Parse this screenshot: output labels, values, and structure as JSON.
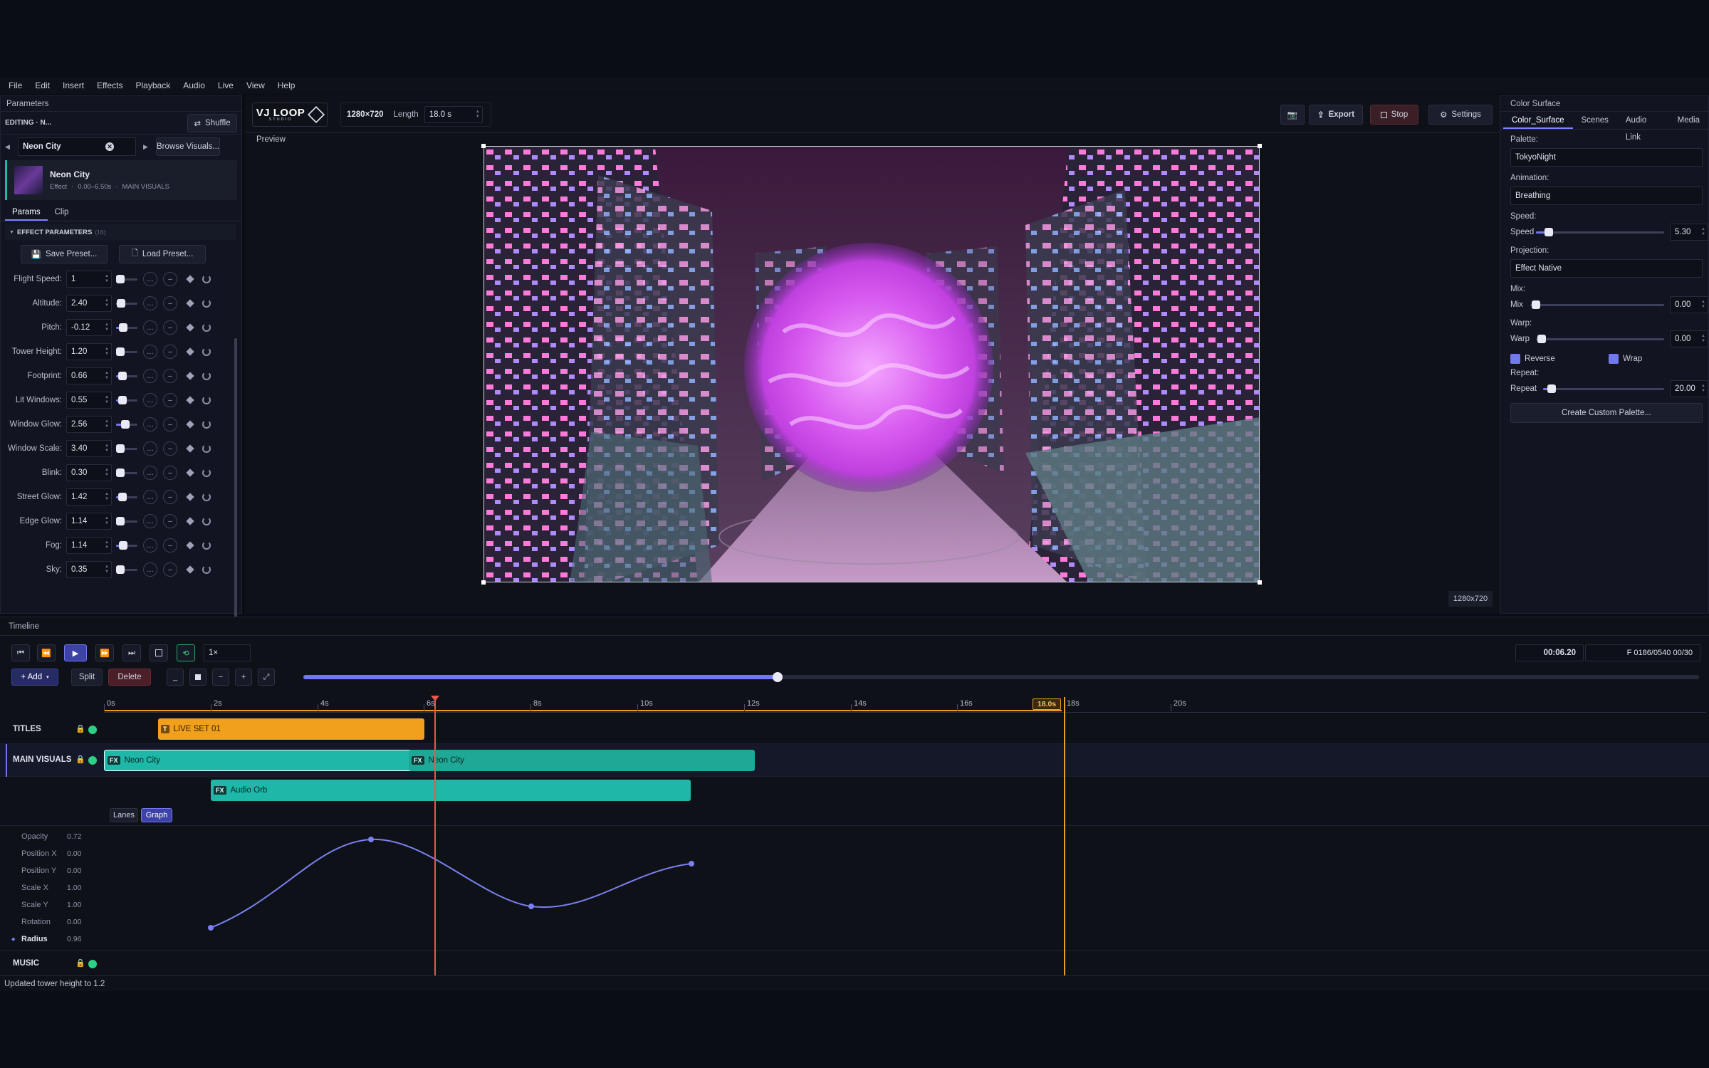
{
  "menu": [
    "File",
    "Edit",
    "Insert",
    "Effects",
    "Playback",
    "Audio",
    "Live",
    "View",
    "Help"
  ],
  "left": {
    "title": "Parameters",
    "editing": "EDITING · N...",
    "shuffle": "Shuffle",
    "effect_name": "Neon City",
    "browse": "Browse Visuals...",
    "card": {
      "name": "Neon City",
      "meta1": "Effect",
      "meta2": "0.00–6.50s",
      "meta3": "MAIN VISUALS"
    },
    "tabs": [
      "Params",
      "Clip"
    ],
    "section": "EFFECT PARAMETERS",
    "section_count": "(16)",
    "save_preset": "Save Preset...",
    "load_preset": "Load Preset...",
    "params": [
      {
        "label": "Flight Speed:",
        "value": "1",
        "level": 0.08
      },
      {
        "label": "Altitude:",
        "value": "2.40",
        "level": 0.22
      },
      {
        "label": "Pitch:",
        "value": "-0.12",
        "level": 0.32
      },
      {
        "label": "Tower Height:",
        "value": "1.20",
        "level": 0.2
      },
      {
        "label": "Footprint:",
        "value": "0.66",
        "level": 0.3
      },
      {
        "label": "Lit Windows:",
        "value": "0.55",
        "level": 0.3
      },
      {
        "label": "Window Glow:",
        "value": "2.56",
        "level": 0.42
      },
      {
        "label": "Window Scale:",
        "value": "3.40",
        "level": 0.2
      },
      {
        "label": "Blink:",
        "value": "0.30",
        "level": 0.2
      },
      {
        "label": "Street Glow:",
        "value": "1.42",
        "level": 0.3
      },
      {
        "label": "Edge Glow:",
        "value": "1.14",
        "level": 0.2
      },
      {
        "label": "Fog:",
        "value": "1.14",
        "level": 0.32
      },
      {
        "label": "Sky:",
        "value": "0.35",
        "level": 0.2
      }
    ]
  },
  "center": {
    "logo_main": "VJ LOOP",
    "logo_sub": "STUDIO",
    "resolution": "1280×720",
    "length_label": "Length",
    "length_value": "18.0 s",
    "export": "Export",
    "stop": "Stop",
    "settings": "Settings",
    "preview_label": "Preview",
    "res_badge": "1280x720"
  },
  "right": {
    "title": "Color Surface",
    "tabs": [
      "Color_Surface",
      "Scenes",
      "Audio Link",
      "Media"
    ],
    "palette_label": "Palette:",
    "palette": "TokyoNight",
    "animation_label": "Animation:",
    "animation": "Breathing",
    "speed_section": "Speed:",
    "speed_label": "Speed",
    "speed_value": "5.30",
    "projection_label": "Projection:",
    "projection": "Effect Native",
    "mix_section": "Mix:",
    "mix_label": "Mix",
    "mix_value": "0.00",
    "warp_section": "Warp:",
    "warp_label": "Warp",
    "warp_value": "0.00",
    "reverse": "Reverse",
    "wrap": "Wrap",
    "repeat_section": "Repeat:",
    "repeat_label": "Repeat",
    "repeat_value": "20.00",
    "create_palette": "Create Custom Palette..."
  },
  "timeline": {
    "title": "Timeline",
    "rate": "1×",
    "time": "00:06.20",
    "frames": "F 0186/0540  00/30",
    "add": "+ Add",
    "split": "Split",
    "delete": "Delete",
    "ruler": [
      "0s",
      "2s",
      "4s",
      "6s",
      "8s",
      "10s",
      "12s",
      "14s",
      "16s",
      "18s",
      "20s"
    ],
    "end_marker": "18.0s",
    "tracks": {
      "titles": "TITLES",
      "main": "MAIN VISUALS",
      "music": "MUSIC"
    },
    "clips": {
      "title_clip": "LIVE SET 01",
      "nc1": "Neon City",
      "nc2": "Neon City",
      "orb": "Audio Orb"
    },
    "fx_badge": "FX",
    "title_badge": "T",
    "view_tabs": [
      "Lanes",
      "Graph"
    ],
    "graph_params": [
      {
        "name": "Opacity",
        "value": "0.72"
      },
      {
        "name": "Position X",
        "value": "0.00"
      },
      {
        "name": "Position Y",
        "value": "0.00"
      },
      {
        "name": "Scale X",
        "value": "1.00"
      },
      {
        "name": "Scale Y",
        "value": "1.00"
      },
      {
        "name": "Rotation",
        "value": "0.00"
      },
      {
        "name": "Radius",
        "value": "0.96"
      }
    ]
  },
  "status": "Updated tower height to 1.2",
  "colors": {
    "accent": "#7279f0",
    "teal": "#1fb8a8",
    "orange": "#f0a01c",
    "playhead": "#e5574f",
    "end": "#e8a020"
  }
}
